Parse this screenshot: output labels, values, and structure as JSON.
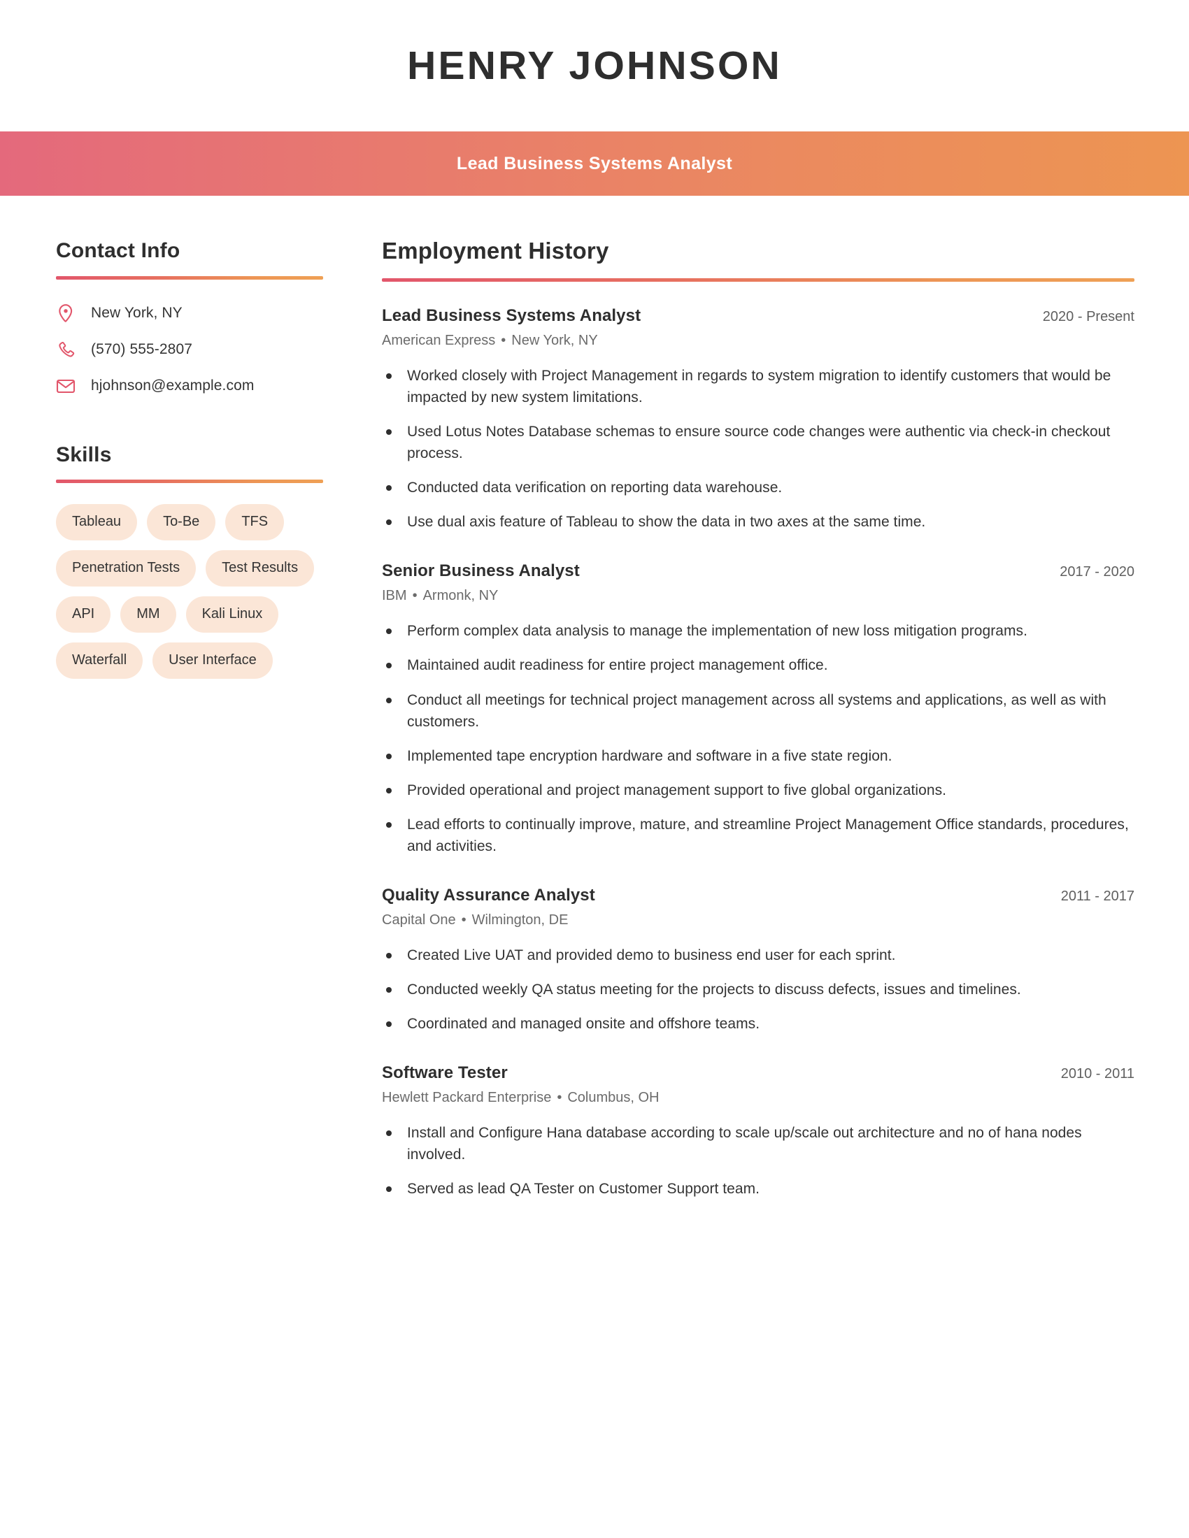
{
  "header": {
    "name": "HENRY JOHNSON",
    "title": "Lead Business Systems Analyst",
    "gradient_start": "#e4697c",
    "gradient_end": "#ed9552"
  },
  "sidebar": {
    "contact": {
      "heading": "Contact Info",
      "items": [
        {
          "icon": "location-pin-icon",
          "value": "New York, NY"
        },
        {
          "icon": "phone-icon",
          "value": "(570) 555-2807"
        },
        {
          "icon": "envelope-icon",
          "value": "hjohnson@example.com"
        }
      ]
    },
    "skills": {
      "heading": "Skills",
      "items": [
        "Tableau",
        "To-Be",
        "TFS",
        "Penetration Tests",
        "Test Results",
        "API",
        "MM",
        "Kali Linux",
        "Waterfall",
        "User Interface"
      ],
      "pill_background": "#fbe6d7"
    }
  },
  "main": {
    "heading": "Employment History",
    "jobs": [
      {
        "title": "Lead Business Systems Analyst",
        "company": "American Express",
        "location": "New York, NY",
        "separator": "•",
        "dates": "2020 - Present",
        "bullets": [
          "Worked closely with Project Management in regards to system migration to identify customers that would be impacted by new system limitations.",
          "Used Lotus Notes Database schemas to ensure source code changes were authentic via check-in checkout process.",
          "Conducted data verification on reporting data warehouse.",
          "Use dual axis feature of Tableau to show the data in two axes at the same time."
        ]
      },
      {
        "title": "Senior Business Analyst",
        "company": "IBM",
        "location": "Armonk, NY",
        "separator": "•",
        "dates": "2017 - 2020",
        "bullets": [
          "Perform complex data analysis to manage the implementation of new loss mitigation programs.",
          "Maintained audit readiness for entire project management office.",
          "Conduct all meetings for technical project management across all systems and applications, as well as with customers.",
          "Implemented tape encryption hardware and software in a five state region.",
          "Provided operational and project management support to five global organizations.",
          "Lead efforts to continually improve, mature, and streamline Project Management Office standards, procedures, and activities."
        ]
      },
      {
        "title": "Quality Assurance Analyst",
        "company": "Capital One",
        "location": "Wilmington, DE",
        "separator": "•",
        "dates": "2011 - 2017",
        "bullets": [
          "Created Live UAT and provided demo to business end user for each sprint.",
          "Conducted weekly QA status meeting for the projects to discuss defects, issues and timelines.",
          "Coordinated and managed onsite and offshore teams."
        ]
      },
      {
        "title": "Software Tester",
        "company": "Hewlett Packard Enterprise",
        "location": "Columbus, OH",
        "separator": "•",
        "dates": "2010 - 2011",
        "bullets": [
          "Install and Configure Hana database according to scale up/scale out architecture and no of hana nodes involved.",
          "Served as lead QA Tester on Customer Support team."
        ]
      }
    ]
  }
}
